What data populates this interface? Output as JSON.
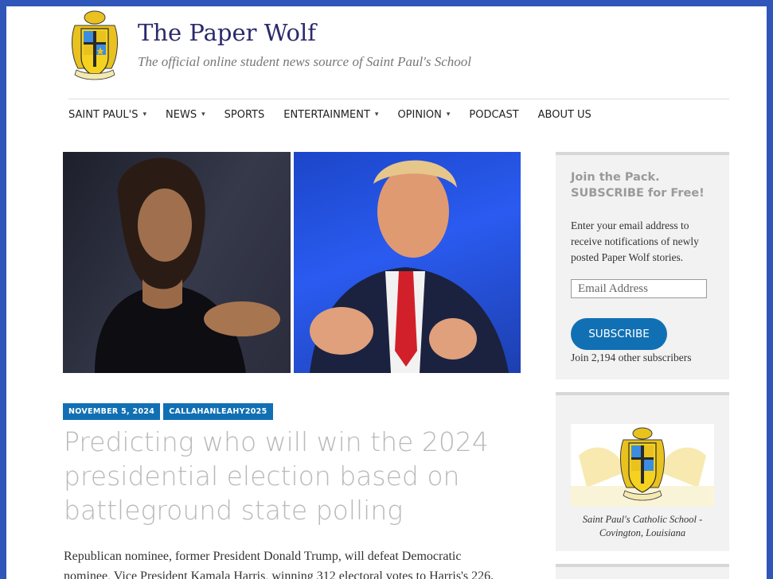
{
  "site": {
    "title": "The Paper Wolf",
    "tagline": "The official online student news source of Saint Paul's School"
  },
  "nav": {
    "items": [
      {
        "label": "SAINT PAUL'S",
        "has_dropdown": true
      },
      {
        "label": "NEWS",
        "has_dropdown": true
      },
      {
        "label": "SPORTS",
        "has_dropdown": false
      },
      {
        "label": "ENTERTAINMENT",
        "has_dropdown": true
      },
      {
        "label": "OPINION",
        "has_dropdown": true
      },
      {
        "label": "PODCAST",
        "has_dropdown": false
      },
      {
        "label": "ABOUT US",
        "has_dropdown": false
      }
    ]
  },
  "article": {
    "date": "NOVEMBER 5, 2024",
    "author": "CALLAHANLEAHY2025",
    "headline": "Predicting who will win the 2024 presidential election based on battleground state polling",
    "excerpt": "Republican nominee, former President Donald Trump, will defeat Democratic nominee, Vice President Kamala Harris, winning 312 electoral votes to Harris's 226."
  },
  "sidebar": {
    "subscribe": {
      "title": "Join the Pack. SUBSCRIBE for Free!",
      "text": "Enter your email address to receive notifications of newly posted Paper Wolf stories.",
      "email_placeholder": "Email Address",
      "button_label": "SUBSCRIBE",
      "subscriber_text": "Join 2,194 other subscribers"
    },
    "crest_widget": {
      "caption": "Saint Paul's Catholic School - Covington, Louisiana"
    }
  },
  "colors": {
    "background": "#2f56b8",
    "accent": "#1170b3",
    "title": "#2b2a6b"
  }
}
